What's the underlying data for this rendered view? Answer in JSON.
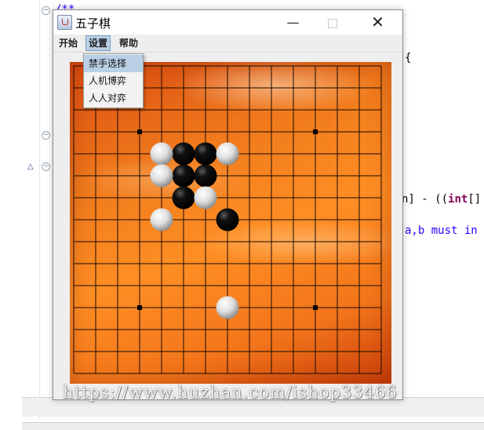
{
  "ide": {
    "code_comment": "/**",
    "code_brace": "{",
    "code_line1_pre": "n] - ((",
    "code_line1_key": "int",
    "code_line1_post": "[]",
    "code_line2": "a,b must in"
  },
  "window": {
    "title": "五子棋",
    "min_symbol": "—",
    "close_symbol": "✕"
  },
  "menubar": {
    "items": [
      {
        "label": "开始"
      },
      {
        "label": "设置"
      },
      {
        "label": "帮助"
      }
    ]
  },
  "dropdown": {
    "items": [
      {
        "label": "禁手选择"
      },
      {
        "label": "人机博弈"
      },
      {
        "label": "人人对弈"
      }
    ]
  },
  "board": {
    "size": 15,
    "star_points": [
      [
        3,
        3
      ],
      [
        11,
        3
      ],
      [
        3,
        11
      ],
      [
        11,
        11
      ]
    ],
    "black_stones": [
      [
        5,
        4
      ],
      [
        6,
        4
      ],
      [
        5,
        5
      ],
      [
        6,
        5
      ],
      [
        5,
        6
      ],
      [
        7,
        7
      ]
    ],
    "white_stones": [
      [
        4,
        4
      ],
      [
        7,
        4
      ],
      [
        4,
        5
      ],
      [
        6,
        6
      ],
      [
        4,
        7
      ],
      [
        7,
        11
      ]
    ]
  },
  "watermark": "https://www.huzhan.com/ishop33466"
}
